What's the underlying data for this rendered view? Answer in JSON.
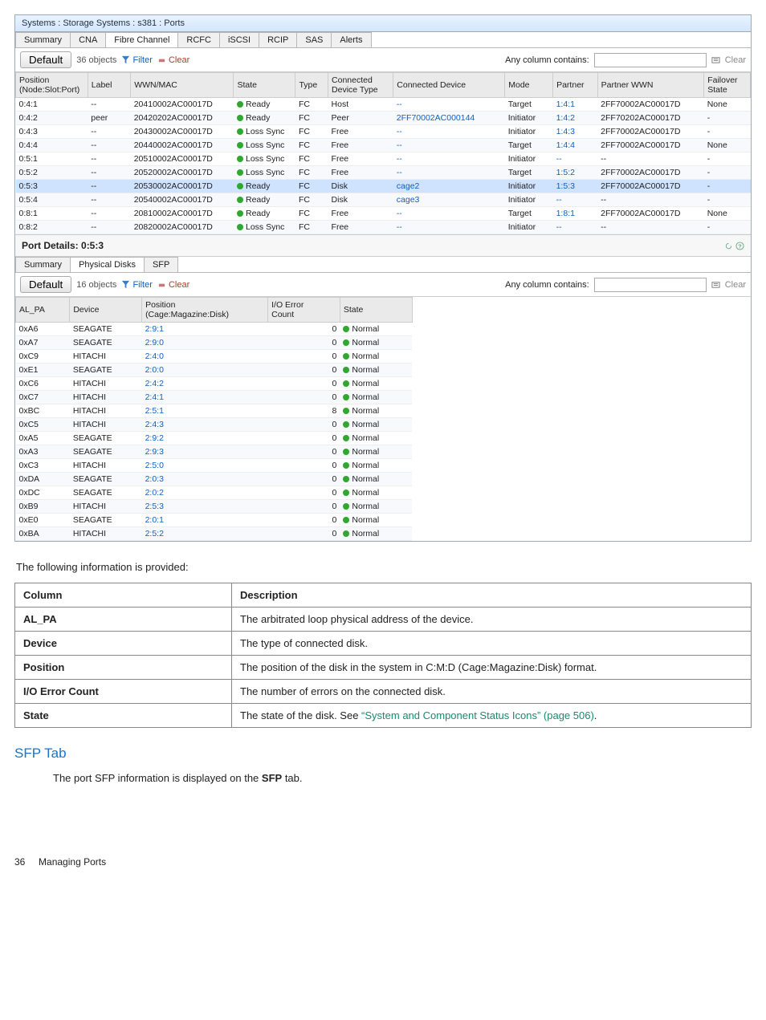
{
  "titlebar": "Systems : Storage Systems : s381 : Ports",
  "upper_tabs": [
    "Summary",
    "CNA",
    "Fibre Channel",
    "RCFC",
    "iSCSI",
    "RCIP",
    "SAS",
    "Alerts"
  ],
  "toolbar": {
    "default_label": "Default",
    "objects_text": "36 objects",
    "filter_label": "Filter",
    "clear_label": "Clear",
    "contains_label": "Any column contains:",
    "search_ph": "",
    "export_label": "",
    "clear2_label": "Clear"
  },
  "ports_cols": [
    "Position\n(Node:Slot:Port)",
    "Label",
    "WWN/MAC",
    "State",
    "Type",
    "Connected\nDevice Type",
    "Connected Device",
    "Mode",
    "Partner",
    "Partner WWN",
    "Failover\nState"
  ],
  "ports_rows": [
    {
      "pos": "0:4:1",
      "label": "--",
      "wwn": "20410002AC00017D",
      "state": "Ready",
      "type": "FC",
      "cdt": "Host",
      "cd": "--",
      "mode": "Target",
      "partner": "1:4:1",
      "pwwn": "2FF70002AC00017D",
      "fail": "None"
    },
    {
      "pos": "0:4:2",
      "label": "peer",
      "wwn": "20420202AC00017D",
      "state": "Ready",
      "type": "FC",
      "cdt": "Peer",
      "cd": "2FF70002AC000144",
      "mode": "Initiator",
      "partner": "1:4:2",
      "pwwn": "2FF70202AC00017D",
      "fail": "-"
    },
    {
      "pos": "0:4:3",
      "label": "--",
      "wwn": "20430002AC00017D",
      "state": "Loss Sync",
      "type": "FC",
      "cdt": "Free",
      "cd": "--",
      "mode": "Initiator",
      "partner": "1:4:3",
      "pwwn": "2FF70002AC00017D",
      "fail": "-"
    },
    {
      "pos": "0:4:4",
      "label": "--",
      "wwn": "20440002AC00017D",
      "state": "Loss Sync",
      "type": "FC",
      "cdt": "Free",
      "cd": "--",
      "mode": "Target",
      "partner": "1:4:4",
      "pwwn": "2FF70002AC00017D",
      "fail": "None"
    },
    {
      "pos": "0:5:1",
      "label": "--",
      "wwn": "20510002AC00017D",
      "state": "Loss Sync",
      "type": "FC",
      "cdt": "Free",
      "cd": "--",
      "mode": "Initiator",
      "partner": "--",
      "pwwn": "--",
      "fail": "-"
    },
    {
      "pos": "0:5:2",
      "label": "--",
      "wwn": "20520002AC00017D",
      "state": "Loss Sync",
      "type": "FC",
      "cdt": "Free",
      "cd": "--",
      "mode": "Target",
      "partner": "1:5:2",
      "pwwn": "2FF70002AC00017D",
      "fail": "-"
    },
    {
      "pos": "0:5:3",
      "label": "--",
      "wwn": "20530002AC00017D",
      "state": "Ready",
      "type": "FC",
      "cdt": "Disk",
      "cd": "cage2",
      "mode": "Initiator",
      "partner": "1:5:3",
      "pwwn": "2FF70002AC00017D",
      "fail": "-",
      "sel": true
    },
    {
      "pos": "0:5:4",
      "label": "--",
      "wwn": "20540002AC00017D",
      "state": "Ready",
      "type": "FC",
      "cdt": "Disk",
      "cd": "cage3",
      "mode": "Initiator",
      "partner": "--",
      "pwwn": "--",
      "fail": "-"
    },
    {
      "pos": "0:8:1",
      "label": "--",
      "wwn": "20810002AC00017D",
      "state": "Ready",
      "type": "FC",
      "cdt": "Free",
      "cd": "--",
      "mode": "Target",
      "partner": "1:8:1",
      "pwwn": "2FF70002AC00017D",
      "fail": "None"
    },
    {
      "pos": "0:8:2",
      "label": "--",
      "wwn": "20820002AC00017D",
      "state": "Loss Sync",
      "type": "FC",
      "cdt": "Free",
      "cd": "--",
      "mode": "Initiator",
      "partner": "--",
      "pwwn": "--",
      "fail": "-"
    }
  ],
  "detail_title": "Port Details: 0:5:3",
  "lower_tabs": [
    "Summary",
    "Physical Disks",
    "SFP"
  ],
  "toolbar2": {
    "default_label": "Default",
    "objects_text": "16 objects",
    "filter_label": "Filter",
    "clear_label": "Clear",
    "contains_label": "Any column contains:",
    "clear2_label": "Clear"
  },
  "disks_cols": [
    "AL_PA",
    "Device",
    "Position\n(Cage:Magazine:Disk)",
    "I/O Error\nCount",
    "State"
  ],
  "disks_rows": [
    {
      "al": "0xA6",
      "dev": "SEAGATE",
      "pos": "2:9:1",
      "io": "0",
      "st": "Normal"
    },
    {
      "al": "0xA7",
      "dev": "SEAGATE",
      "pos": "2:9:0",
      "io": "0",
      "st": "Normal"
    },
    {
      "al": "0xC9",
      "dev": "HITACHI",
      "pos": "2:4:0",
      "io": "0",
      "st": "Normal"
    },
    {
      "al": "0xE1",
      "dev": "SEAGATE",
      "pos": "2:0:0",
      "io": "0",
      "st": "Normal"
    },
    {
      "al": "0xC6",
      "dev": "HITACHI",
      "pos": "2:4:2",
      "io": "0",
      "st": "Normal"
    },
    {
      "al": "0xC7",
      "dev": "HITACHI",
      "pos": "2:4:1",
      "io": "0",
      "st": "Normal"
    },
    {
      "al": "0xBC",
      "dev": "HITACHI",
      "pos": "2:5:1",
      "io": "8",
      "st": "Normal"
    },
    {
      "al": "0xC5",
      "dev": "HITACHI",
      "pos": "2:4:3",
      "io": "0",
      "st": "Normal"
    },
    {
      "al": "0xA5",
      "dev": "SEAGATE",
      "pos": "2:9:2",
      "io": "0",
      "st": "Normal"
    },
    {
      "al": "0xA3",
      "dev": "SEAGATE",
      "pos": "2:9:3",
      "io": "0",
      "st": "Normal"
    },
    {
      "al": "0xC3",
      "dev": "HITACHI",
      "pos": "2:5:0",
      "io": "0",
      "st": "Normal"
    },
    {
      "al": "0xDA",
      "dev": "SEAGATE",
      "pos": "2:0:3",
      "io": "0",
      "st": "Normal"
    },
    {
      "al": "0xDC",
      "dev": "SEAGATE",
      "pos": "2:0:2",
      "io": "0",
      "st": "Normal"
    },
    {
      "al": "0xB9",
      "dev": "HITACHI",
      "pos": "2:5:3",
      "io": "0",
      "st": "Normal"
    },
    {
      "al": "0xE0",
      "dev": "SEAGATE",
      "pos": "2:0:1",
      "io": "0",
      "st": "Normal"
    },
    {
      "al": "0xBA",
      "dev": "HITACHI",
      "pos": "2:5:2",
      "io": "0",
      "st": "Normal"
    }
  ],
  "prose_intro": "The following information is provided:",
  "desc_head": [
    "Column",
    "Description"
  ],
  "desc_rows": [
    [
      "AL_PA",
      "The arbitrated loop physical address of the device."
    ],
    [
      "Device",
      "The type of connected disk."
    ],
    [
      "Position",
      "The position of the disk in the system in C:M:D (Cage:Magazine:Disk) format."
    ],
    [
      "I/O Error Count",
      "The number of errors on the connected disk."
    ],
    [
      "State",
      "The state of the disk. See “System and Component Status Icons” (page 506)."
    ]
  ],
  "sfp_heading": "SFP Tab",
  "sfp_body_a": "The port SFP information is displayed on the ",
  "sfp_body_b": "SFP",
  "sfp_body_c": " tab.",
  "footer_page": "36",
  "footer_section": "Managing Ports"
}
